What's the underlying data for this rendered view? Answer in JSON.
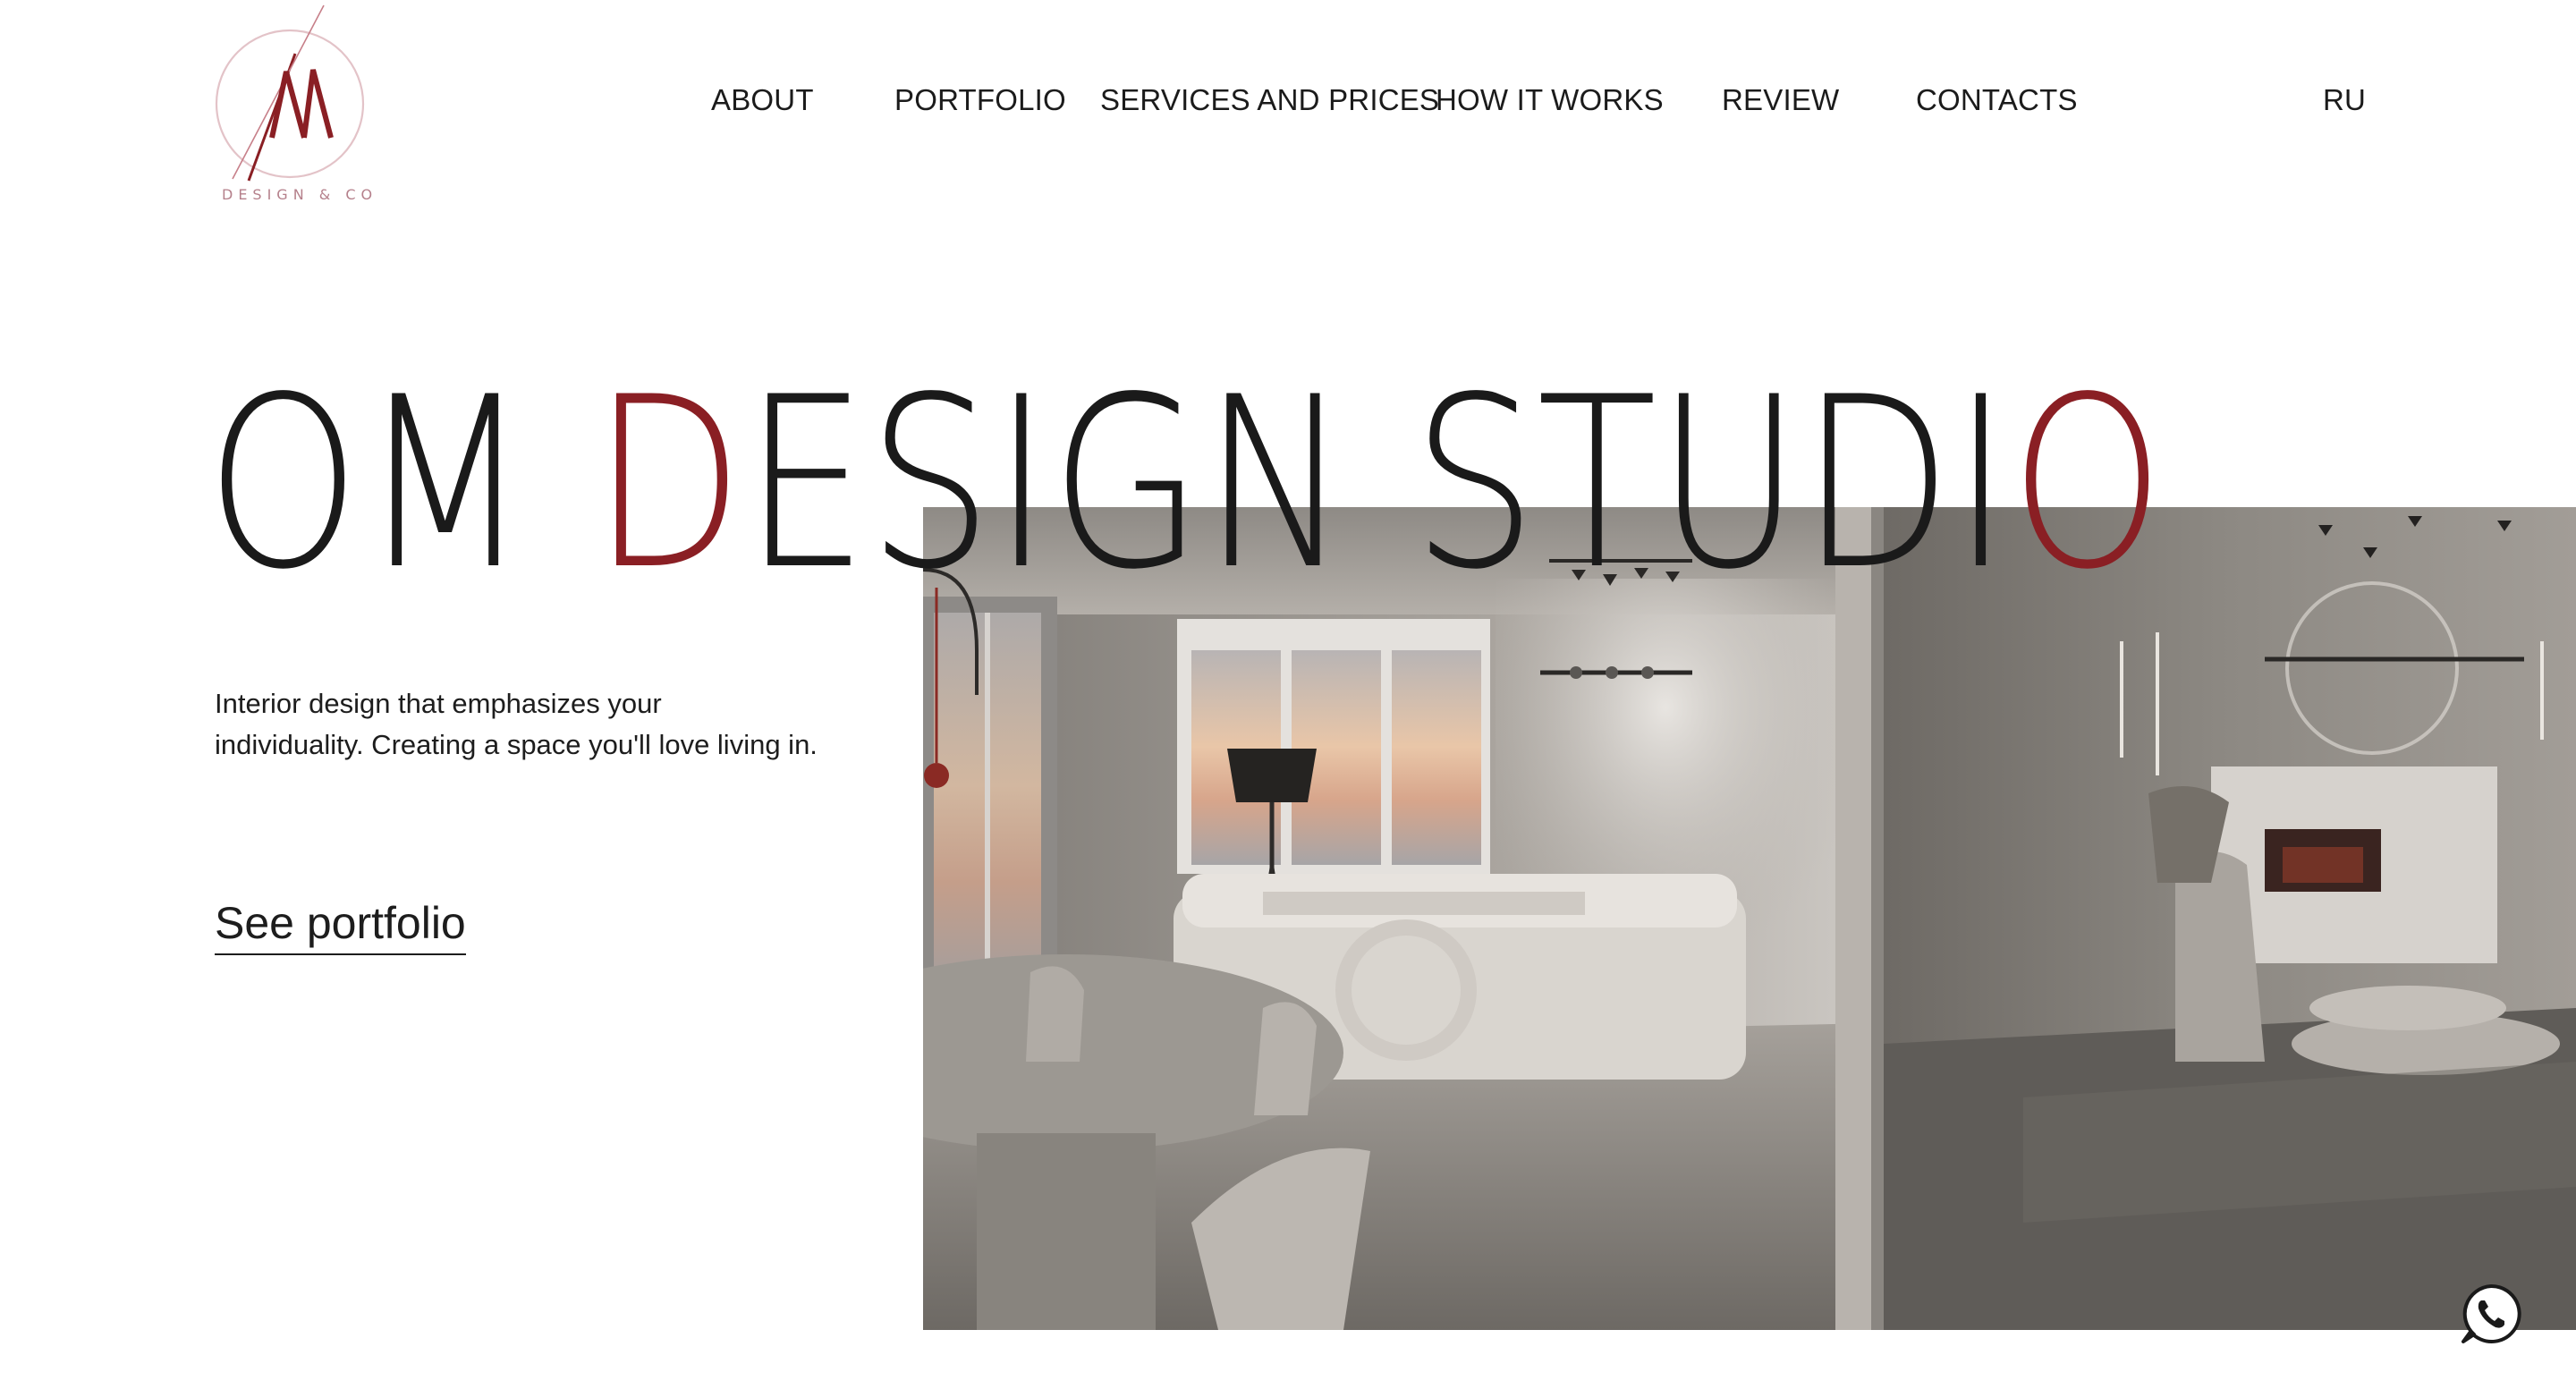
{
  "logo": {
    "caption": "DESIGN & CO",
    "accent_color": "#8a1f24",
    "ring_color": "#e3c3c8"
  },
  "nav": {
    "items": [
      {
        "label": "ABOUT"
      },
      {
        "label": "PORTFOLIO"
      },
      {
        "label": "SERVICES AND PRICES"
      },
      {
        "label": "HOW IT WORKS"
      },
      {
        "label": "REVIEW"
      },
      {
        "label": "CONTACTS"
      }
    ],
    "language": "RU"
  },
  "hero": {
    "title_parts": {
      "part1": "OM ",
      "accent1": "D",
      "part2": "ESIGN STUDI",
      "accent2": "O"
    },
    "title_color": "#1a1a1a",
    "accent_color": "#8a1f24",
    "tagline_line1": "Interior design that emphasizes your",
    "tagline_line2": "individuality. Creating a space you'll love living in.",
    "cta_label": "See portfolio"
  },
  "icons": {
    "whatsapp": "whatsapp-icon"
  }
}
